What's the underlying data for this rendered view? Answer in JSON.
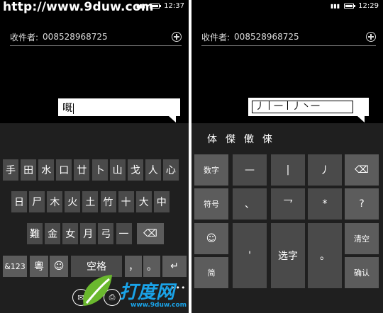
{
  "watermark": {
    "url": "http://www.9duw.com",
    "logo_text": "打度网",
    "logo_url": "www.9duw.com"
  },
  "left": {
    "status_time": "12:37",
    "recipient_label": "收件者:",
    "recipient_value": "008528968725",
    "compose_text": "嘅",
    "rows": [
      [
        "手",
        "田",
        "水",
        "口",
        "廿",
        "卜",
        "山",
        "戈",
        "人",
        "心"
      ],
      [
        "日",
        "尸",
        "木",
        "火",
        "土",
        "竹",
        "十",
        "大",
        "中"
      ],
      [
        "難",
        "金",
        "女",
        "月",
        "弓",
        "一"
      ]
    ],
    "bottom": {
      "sym": "&123",
      "lang": "粵",
      "space": "空格",
      "comma": "，",
      "period": "。"
    }
  },
  "right": {
    "status_time": "12:29",
    "recipient_label": "收件者:",
    "recipient_value": "008528968725",
    "stroke_text": "丿丨一丨丿丶一",
    "candidates": [
      "体",
      "傑",
      "僌",
      "倈"
    ],
    "keys": {
      "num": "数字",
      "sym": "符号",
      "simp": "简",
      "confirm_clear": "清空",
      "confirm": "确认",
      "q": "?",
      "h": "—",
      "s": "|",
      "p": "丿",
      "d": "、",
      "z": "乛",
      "star": "*",
      "quote": "'",
      "select": "选字",
      "dot": "。"
    }
  },
  "colors": {
    "key": "#4a4a4a",
    "kb_bg": "#1f1f1f",
    "accent": "#1aa3e8"
  }
}
